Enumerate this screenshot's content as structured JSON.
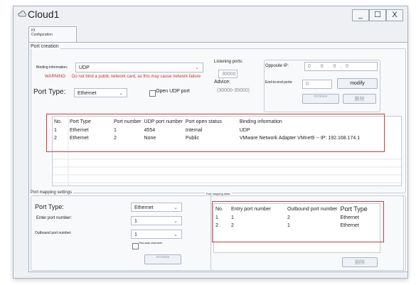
{
  "window": {
    "title": "Cloud1",
    "minimize": "_",
    "maximize": "☐",
    "close": "X"
  },
  "tab": {
    "label_line1": "IO",
    "label_line2": "Configuration"
  },
  "port_creation": {
    "section_label": "Port creation",
    "binding_label": "Binding information:",
    "binding_value": "UDP",
    "warning_label": "WARNING:",
    "warning_text": "Do not bind a public network card, as this may cause network failure",
    "port_type_label": "Port Type:",
    "port_type_value": "Ethernet",
    "open_udp_label": "Open UDP port",
    "listening_label": "Listening ports:",
    "listening_value": "30000",
    "advice_label": "Advice:",
    "advice_value": "(30000-35000)",
    "opposite_ip_label": "Opposite IP:",
    "opposite_ip_value": "0 . 0 . 0 . 0",
    "end_to_end_label": "End-to-end ports:",
    "end_to_end_value": "0",
    "modify_button": "modify",
    "increase_button": "increase",
    "delete_button": "删除"
  },
  "port_table": {
    "columns": [
      "No.",
      "Port Type",
      "Port number",
      "UDP port number",
      "Port open status",
      "Binding information"
    ],
    "rows": [
      [
        "1",
        "Ethernet",
        "1",
        "4554",
        "Internal",
        "UDP"
      ],
      [
        "2",
        "Ethernet",
        "2",
        "None",
        "Public",
        "VMware Network Adapter VMnet9 -- IP: 192.168.174.1"
      ]
    ]
  },
  "port_mapping": {
    "section_label": "Port mapping settings",
    "port_type_label": "Port Type:",
    "port_type_value": "Ethernet",
    "entry_label": "Enter port number:",
    "entry_value": "1",
    "outbound_label": "Outbound port number:",
    "outbound_value": "1",
    "two_way_label": "Two-way channels",
    "increase_button": "increase",
    "table_title": "Port mapping table",
    "columns": [
      "No.",
      "Entry port number",
      "Outbound port number",
      "Port Type"
    ],
    "rows": [
      [
        "1",
        "1",
        "2",
        "Ethernet"
      ],
      [
        "2",
        "2",
        "1",
        "Ethernet"
      ]
    ],
    "delete_button": "删除"
  }
}
